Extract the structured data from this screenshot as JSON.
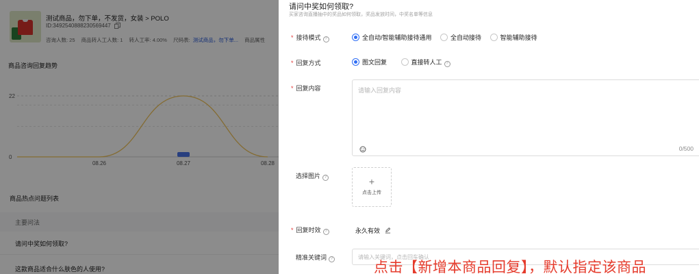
{
  "product": {
    "title": "测试商品，勿下单，不发货，女装 > POLO",
    "id": "ID:3492540888230569447",
    "stats": [
      {
        "label": "咨询人数: 25"
      },
      {
        "label": "商品转人工人数: 1"
      },
      {
        "label": "转人工率: 4.00%"
      },
      {
        "label": "尺码表:"
      },
      {
        "label": "测试商品，勿下单..."
      },
      {
        "label": "商品属性"
      }
    ]
  },
  "trend": {
    "title": "商品咨询回复趋势"
  },
  "chart_data": {
    "type": "line",
    "x": [
      "08.26",
      "08.27",
      "08.28"
    ],
    "y_ticks": [
      0,
      22
    ],
    "ylim": [
      0,
      22
    ],
    "series": [
      {
        "values": [
          0,
          22,
          0
        ],
        "color": "#f0c35a"
      }
    ],
    "highlight": "08.27"
  },
  "hot": {
    "title": "商品热点问题列表",
    "header": "主要问法",
    "rows": [
      "请问中奖如何领取?",
      "这款商品适合什么肤色的人使用?"
    ]
  },
  "drawer": {
    "title": "请问中奖如何领取?",
    "subtitle": "买家咨询直播抽中的奖品如何领取，奖品发放时间，中奖名单等信息",
    "mode": {
      "label": "接待模式",
      "options": [
        "全自动/智能辅助接待通用",
        "全自动接待",
        "智能辅助接待"
      ],
      "selected": 0
    },
    "reply_type": {
      "label": "回复方式",
      "options": [
        "图文回复",
        "直接转人工"
      ],
      "selected": 0
    },
    "content": {
      "label": "回复内容",
      "placeholder": "请输入回复内容",
      "counter": "0/500"
    },
    "image": {
      "label": "选择图片",
      "upload_plus": "+",
      "upload_text": "点击上传"
    },
    "validity": {
      "label": "回复时效",
      "value": "永久有效"
    },
    "keywords": {
      "label": "精准关键词",
      "placeholder": "请输入关键词，点击回车确认"
    }
  },
  "annotation": "点击【新增本商品回复】，默认指定该商品",
  "colors": {
    "accent": "#2f6ef5",
    "required": "#e23a3a",
    "annotation": "#e53b2c",
    "chart_line": "#f0c35a"
  }
}
